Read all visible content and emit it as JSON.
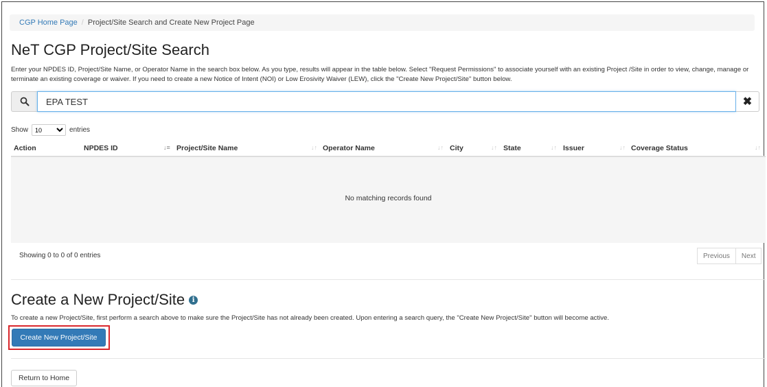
{
  "breadcrumb": {
    "home": "CGP Home Page",
    "separator": "/",
    "current": "Project/Site Search and Create New Project Page"
  },
  "search_section": {
    "title": "NeT CGP Project/Site Search",
    "description": "Enter your NPDES ID, Project/Site Name, or Operator Name in the search box below. As you type, results will appear in the table below. Select \"Request Permissions\" to associate yourself with an existing Project /Site in order to view, change, manage or terminate an existing coverage or waiver. If you need to create a new Notice of Intent (NOI) or Low Erosivity Waiver (LEW), click the \"Create New Project/Site\" button below.",
    "search_value": "EPA TEST",
    "search_icon": "search-icon",
    "clear_icon": "close-icon"
  },
  "table": {
    "length_prefix": "Show",
    "length_value": "10",
    "length_suffix": "entries",
    "columns": [
      "Action",
      "NPDES ID",
      "Project/Site Name",
      "Operator Name",
      "City",
      "State",
      "Issuer",
      "Coverage Status"
    ],
    "empty_message": "No matching records found",
    "info": "Showing 0 to 0 of 0 entries",
    "pagination": {
      "previous": "Previous",
      "next": "Next"
    }
  },
  "create_section": {
    "title": "Create a New Project/Site",
    "info_icon": "info-circle-icon",
    "note": "To create a new Project/Site, first perform a search above to make sure the Project/Site has not already been created. Upon entering a search query, the \"Create New Project/Site\" button will become active.",
    "button": "Create New Project/Site",
    "highlight_color": "#d9262b"
  },
  "footer": {
    "return_button": "Return to Home"
  },
  "colors": {
    "primary": "#337ab7",
    "link": "#337ab7",
    "focus_border": "#66afe9"
  }
}
